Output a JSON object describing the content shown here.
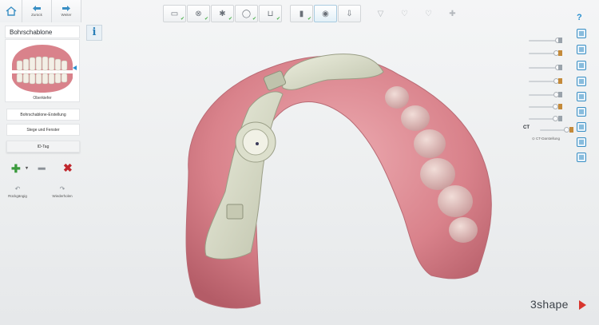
{
  "nav": {
    "home_icon": "home-icon",
    "back_label": "Zurück",
    "forward_label": "Weiter"
  },
  "panel": {
    "title": "Bohrschablone",
    "info_label": "i",
    "jaw_caption": "Oberkiefer"
  },
  "steps": [
    {
      "label": "Bohrschablone-Erstellung"
    },
    {
      "label": "Stege und Fenster"
    },
    {
      "label": "ID-Tag"
    }
  ],
  "actions": {
    "undo_label": "Rückgängig",
    "redo_label": "Wiederholen"
  },
  "toolbar": {
    "buttons": [
      {
        "icon": "scan-green-icon",
        "glyph": "▭",
        "checked": true,
        "state": "normal"
      },
      {
        "icon": "align-icon",
        "glyph": "⊗",
        "checked": true,
        "state": "normal"
      },
      {
        "icon": "implant-plan-icon",
        "glyph": "✱",
        "checked": true,
        "state": "normal"
      },
      {
        "icon": "crown-icon",
        "glyph": "◯",
        "checked": true,
        "state": "normal"
      },
      {
        "icon": "sleeve-icon",
        "glyph": "⊔",
        "checked": true,
        "state": "normal"
      },
      {
        "icon": "drill-icon",
        "glyph": "▮",
        "checked": true,
        "state": "normal"
      },
      {
        "icon": "guide-icon",
        "glyph": "◉",
        "checked": false,
        "state": "on"
      },
      {
        "icon": "export-icon",
        "glyph": "⇩",
        "checked": false,
        "state": "normal"
      },
      {
        "icon": "funnel-icon",
        "glyph": "▽",
        "checked": false,
        "state": "dim"
      },
      {
        "icon": "tooth-outline-icon",
        "glyph": "♡",
        "checked": false,
        "state": "dim"
      },
      {
        "icon": "tooth-shell-icon",
        "glyph": "♡",
        "checked": false,
        "state": "dim"
      },
      {
        "icon": "cross-puzzle-icon",
        "glyph": "✚",
        "checked": false,
        "state": "dim"
      }
    ],
    "check_glyph": "✔"
  },
  "visibility": {
    "ct_label": "CT",
    "ct_settings_label": "CT-Darstellung",
    "sliders": [
      {
        "name": "slider-jaw-upper",
        "value": 1.0
      },
      {
        "name": "slider-guide",
        "value": 0.95
      },
      {
        "name": "slider-implant",
        "value": 1.0
      },
      {
        "name": "slider-sleeve",
        "value": 0.95
      },
      {
        "name": "slider-drill",
        "value": 0.95
      },
      {
        "name": "slider-nerve",
        "value": 0.9
      },
      {
        "name": "slider-gingiva",
        "value": 0.9
      },
      {
        "name": "slider-ct",
        "value": 0.92
      }
    ]
  },
  "help_label": "?",
  "brand": "3shape",
  "colors": {
    "accent": "#2a8fcf",
    "add": "#3a9a3c",
    "delete": "#c0272d",
    "gum": "#d9828b",
    "guide": "#d5d8c4",
    "brand_triangle": "#d8362f"
  }
}
